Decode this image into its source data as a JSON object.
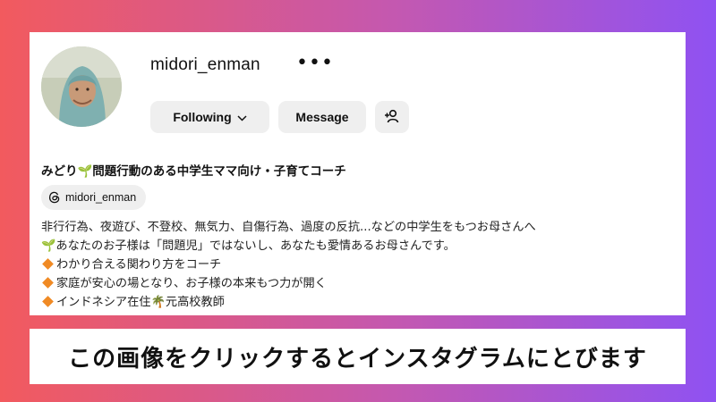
{
  "profile": {
    "username": "midori_enman",
    "more_label": "•••",
    "display_name": "みどり🌱問題行動のある中学生ママ向け・子育てコーチ",
    "threads_handle": "midori_enman"
  },
  "actions": {
    "following_label": "Following",
    "message_label": "Message"
  },
  "bio": {
    "line1": "非行行為、夜遊び、不登校、無気力、自傷行為、過度の反抗...などの中学生をもつお母さんへ",
    "line2": "🌱あなたのお子様は「問題児」ではないし、あなたも愛情あるお母さんです。",
    "line3": "わかり合える関わり方をコーチ",
    "line4": "家庭が安心の場となり、お子様の本来もつ力が開く",
    "line5": "インドネシア在住🌴元高校教師"
  },
  "banner": {
    "text": "この画像をクリックするとインスタグラムにとびます"
  },
  "colors": {
    "gradient_left": "#f25a5e",
    "gradient_right": "#8f52f2",
    "button_bg": "#efefef",
    "bullet": "#f08a24"
  },
  "icons": [
    "more-options-icon",
    "chevron-down-icon",
    "add-user-icon",
    "threads-icon",
    "diamond-bullet-icon"
  ]
}
